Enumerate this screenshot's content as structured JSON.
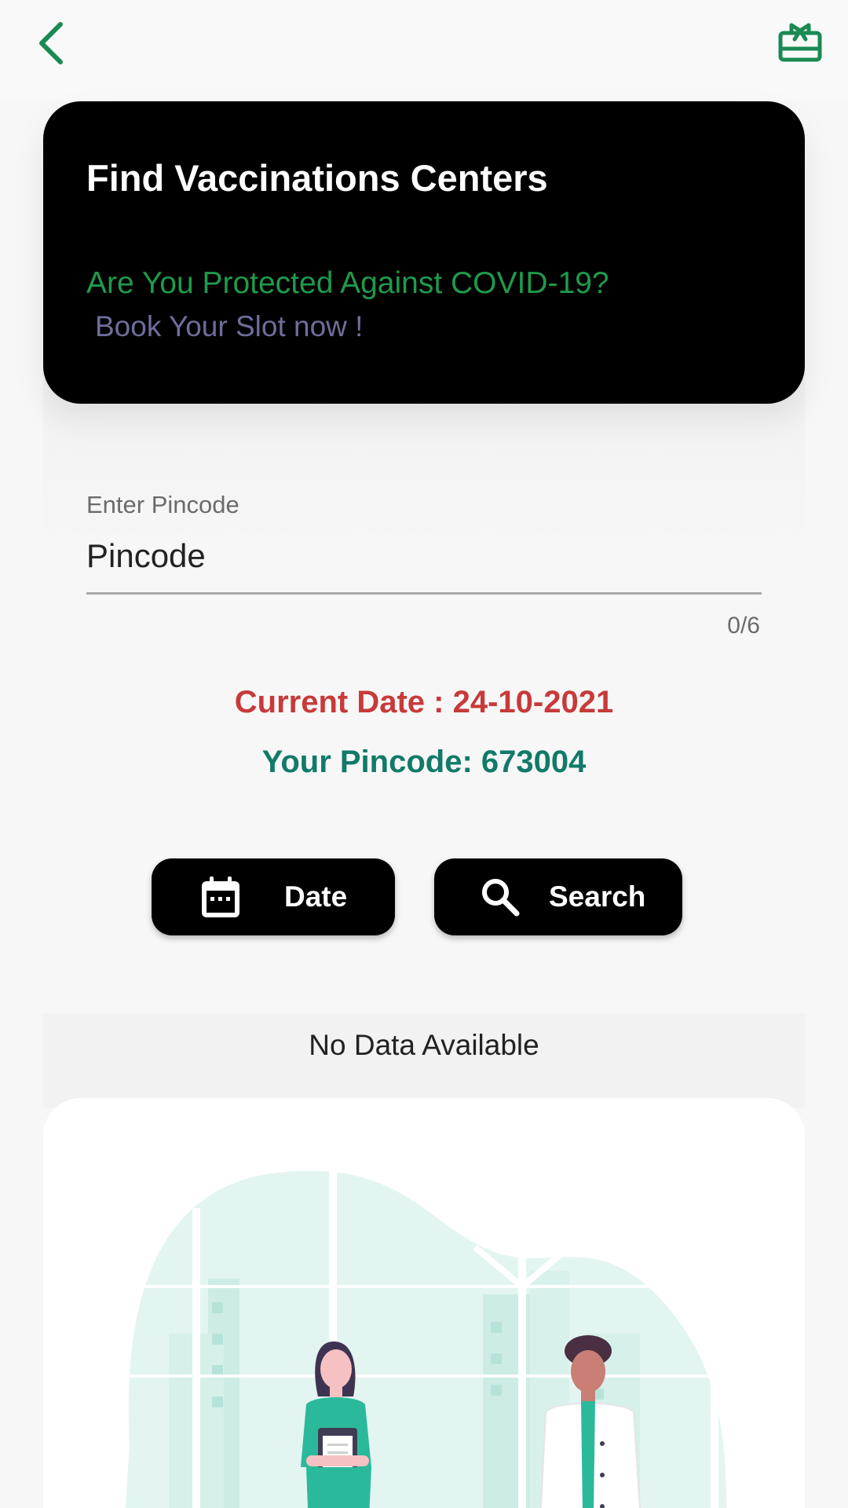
{
  "appbar": {
    "back_icon": "chevron-left-icon",
    "gift_icon": "gift-card-icon",
    "accent_color": "#1a8a52"
  },
  "hero": {
    "title": "Find Vaccinations Centers",
    "subtitle": "Are You Protected Against COVID-19?",
    "tagline": "Book Your Slot now !"
  },
  "pincode_field": {
    "label": "Enter Pincode",
    "placeholder": "Pincode",
    "value": "",
    "counter": "0/6"
  },
  "info": {
    "current_date": "Current Date : 24-10-2021",
    "your_pincode": "Your Pincode: 673004"
  },
  "buttons": {
    "date": {
      "label": "Date",
      "icon": "calendar-icon"
    },
    "search": {
      "label": "Search",
      "icon": "search-icon"
    }
  },
  "results": {
    "empty_text": "No Data Available"
  },
  "colors": {
    "date_red": "#c83a3a",
    "pincode_teal": "#117a68",
    "subtitle_green": "#1f9a4b",
    "tagline_slate": "#6e6e9a",
    "illustration_teal": "#2bb99c"
  }
}
